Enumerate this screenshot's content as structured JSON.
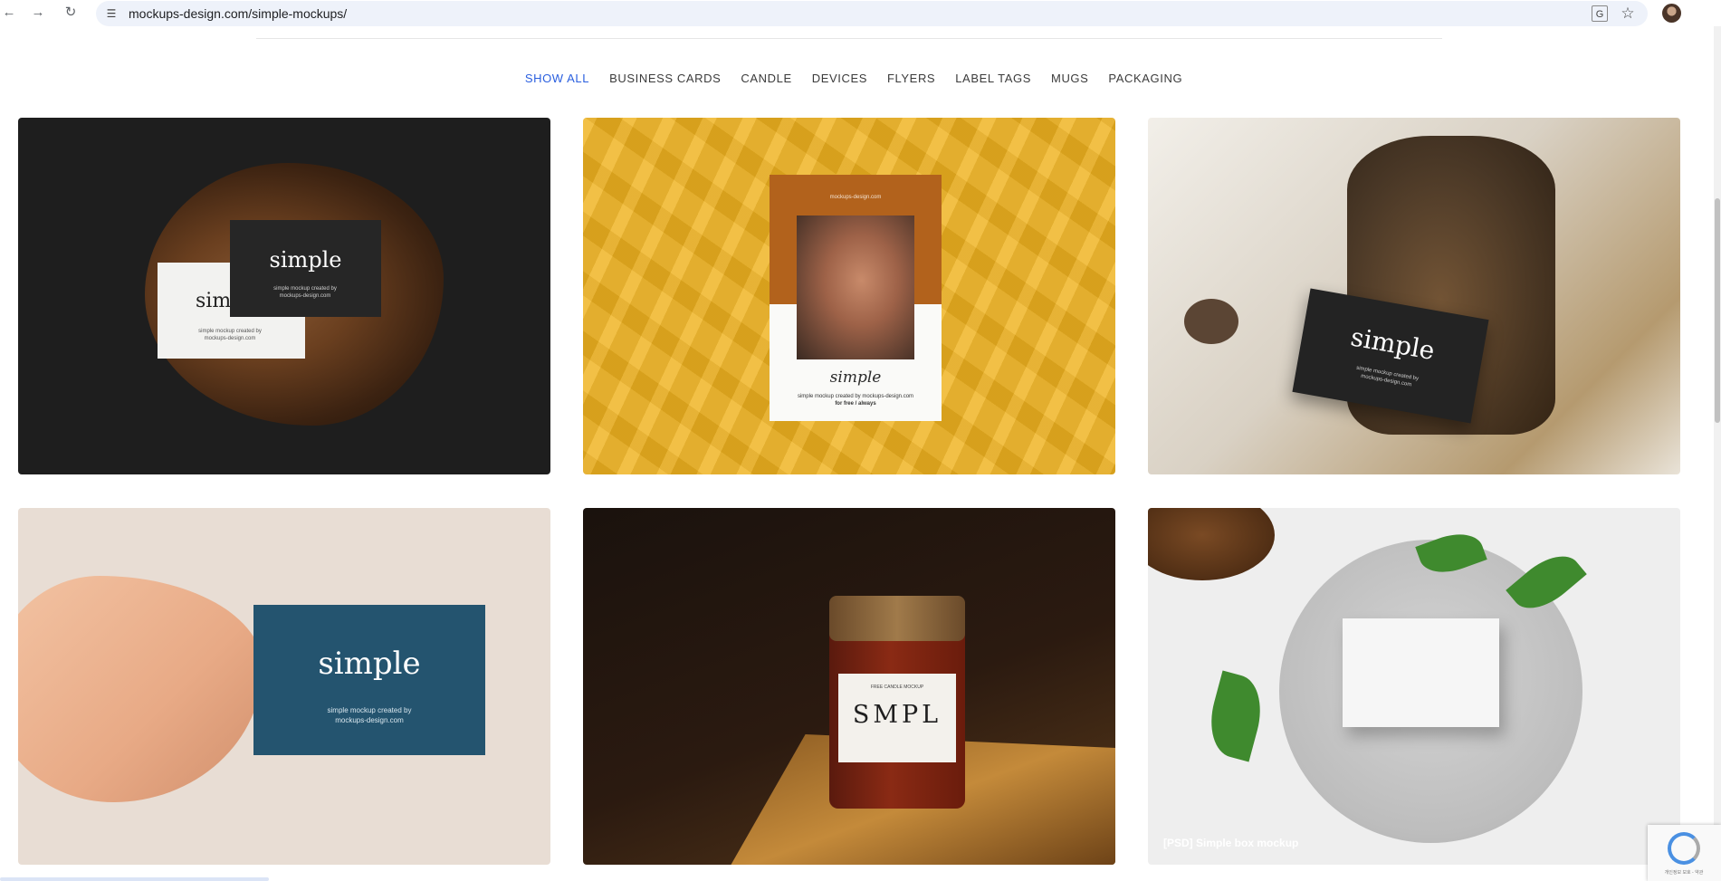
{
  "browser": {
    "url": "mockups-design.com/simple-mockups/",
    "back_icon": "arrow-left-icon",
    "forward_icon": "arrow-right-icon",
    "reload_icon": "reload-icon"
  },
  "filters": {
    "items": [
      {
        "label": "SHOW ALL",
        "active": true
      },
      {
        "label": "BUSINESS CARDS"
      },
      {
        "label": "CANDLE"
      },
      {
        "label": "DEVICES"
      },
      {
        "label": "FLYERS"
      },
      {
        "label": "LABEL TAGS"
      },
      {
        "label": "MUGS"
      },
      {
        "label": "PACKAGING"
      }
    ],
    "active_color": "#2a5fdf"
  },
  "cards": [
    {
      "brand": "simple",
      "brand_partial": "sim",
      "tagline": "simple mockup created by",
      "site": "mockups-design.com"
    },
    {
      "poster_site": "mockups-design.com",
      "signature": "simple",
      "caption1": "simple mockup created by mockups-design.com",
      "caption2": "for free / always"
    },
    {
      "brand": "simple",
      "tagline": "simple mockup created by",
      "site": "mockups-design.com"
    },
    {
      "brand": "simple",
      "tagline": "simple mockup created by",
      "site": "mockups-design.com"
    },
    {
      "label_top": "FREE CANDLE MOCKUP",
      "label_brand": "SMPL"
    },
    {
      "caption": "[PSD] Simple box mockup"
    }
  ],
  "recaptcha": {
    "terms": "개인정보 보호 - 약관"
  }
}
